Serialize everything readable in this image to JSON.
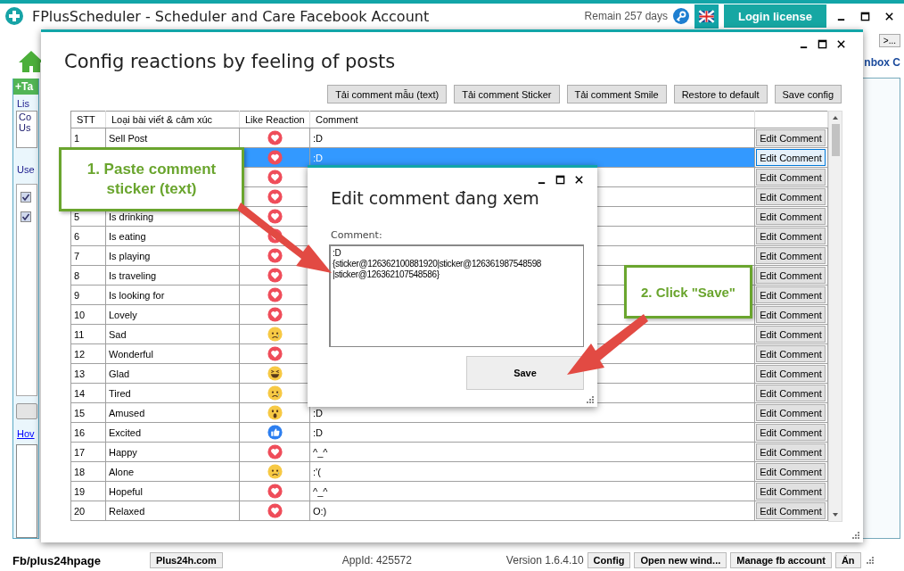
{
  "app": {
    "title": "FPlusScheduler - Scheduler and Care Facebook Account",
    "remain": "Remain 257 days",
    "login_button": "Login license"
  },
  "background": {
    "tab": "+Ta",
    "list_label": "Lis",
    "list_items": [
      "Co",
      "Us"
    ],
    "user_label": "Use",
    "checkboxes": [
      {
        "checked": true
      },
      {
        "checked": true
      }
    ],
    "link": "Hov",
    "right_text": "nbox C",
    "right_button": ">..."
  },
  "config_window": {
    "title": "Config reactions by feeling of posts",
    "buttons": [
      "Tải comment mẫu (text)",
      "Tải comment Sticker",
      "Tải comment Smile",
      "Restore to default",
      "Save config"
    ],
    "columns": [
      "STT",
      "Loại bài viết & cảm xúc",
      "Like Reaction",
      "Comment"
    ],
    "rows": [
      {
        "stt": "1",
        "label": "Sell Post",
        "reaction": {
          "kind": "love"
        },
        "comment": ":D",
        "edit": "Edit Comment",
        "selected": false
      },
      {
        "reaction": {
          "kind": "love"
        },
        "comment": ":D",
        "edit": "Edit Comment",
        "selected": true
      },
      {
        "reaction": {
          "kind": "love"
        },
        "edit": "Edit Comment",
        "selected": false
      },
      {
        "reaction": {
          "kind": "love"
        },
        "edit": "Edit Comment",
        "selected": false
      },
      {
        "stt": "5",
        "label": "Is drinking",
        "reaction": {
          "kind": "love"
        },
        "edit": "Edit Comment",
        "selected": false
      },
      {
        "stt": "6",
        "label": "Is eating",
        "reaction": {
          "kind": "love"
        },
        "edit": "Edit Comment",
        "selected": false
      },
      {
        "stt": "7",
        "label": "Is playing",
        "reaction": {
          "kind": "love"
        },
        "edit": "Edit Comment",
        "selected": false
      },
      {
        "stt": "8",
        "label": "Is traveling",
        "reaction": {
          "kind": "love"
        },
        "edit": "Edit Comment",
        "selected": false
      },
      {
        "stt": "9",
        "label": "Is looking for",
        "reaction": {
          "kind": "love"
        },
        "edit": "Edit Comment",
        "selected": false
      },
      {
        "stt": "10",
        "label": "Lovely",
        "reaction": {
          "kind": "love"
        },
        "edit": "Edit Comment",
        "selected": false
      },
      {
        "stt": "11",
        "label": "Sad",
        "reaction": {
          "kind": "sad"
        },
        "edit": "Edit Comment",
        "selected": false
      },
      {
        "stt": "12",
        "label": "Wonderful",
        "reaction": {
          "kind": "love"
        },
        "edit": "Edit Comment",
        "selected": false
      },
      {
        "stt": "13",
        "label": "Glad",
        "reaction": {
          "kind": "haha"
        },
        "edit": "Edit Comment",
        "selected": false
      },
      {
        "stt": "14",
        "label": "Tired",
        "reaction": {
          "kind": "sad"
        },
        "edit": "Edit Comment",
        "selected": false
      },
      {
        "stt": "15",
        "label": "Amused",
        "reaction": {
          "kind": "wow"
        },
        "comment": ":D",
        "edit": "Edit Comment",
        "selected": false
      },
      {
        "stt": "16",
        "label": "Excited",
        "reaction": {
          "kind": "like"
        },
        "comment": ":D",
        "edit": "Edit Comment",
        "selected": false
      },
      {
        "stt": "17",
        "label": "Happy",
        "reaction": {
          "kind": "love"
        },
        "comment": "^_^",
        "edit": "Edit Comment",
        "selected": false
      },
      {
        "stt": "18",
        "label": "Alone",
        "reaction": {
          "kind": "sad"
        },
        "comment": ":'(",
        "edit": "Edit Comment",
        "selected": false
      },
      {
        "stt": "19",
        "label": "Hopeful",
        "reaction": {
          "kind": "love"
        },
        "comment": "^_^",
        "edit": "Edit Comment",
        "selected": false
      },
      {
        "stt": "20",
        "label": "Relaxed",
        "reaction": {
          "kind": "love"
        },
        "comment": "O:)",
        "edit": "Edit Comment",
        "selected": false
      }
    ]
  },
  "edit_dialog": {
    "title": "Edit comment đang xem",
    "label": "Comment:",
    "value": ":D\n{sticker@126362100881920|sticker@126361987548598\n|sticker@126362107548586}",
    "save_button": "Save"
  },
  "callouts": [
    "1. Paste comment sticker (text)",
    "2. Click \"Save\""
  ],
  "status_bar": {
    "page": "Fb/plus24hpage",
    "site_button": "Plus24h.com",
    "app_id": "AppId: 425572",
    "version": "Version 1.6.4.10",
    "buttons": [
      "Config",
      "Open new wind...",
      "Manage fb account",
      "Ẩn"
    ]
  }
}
